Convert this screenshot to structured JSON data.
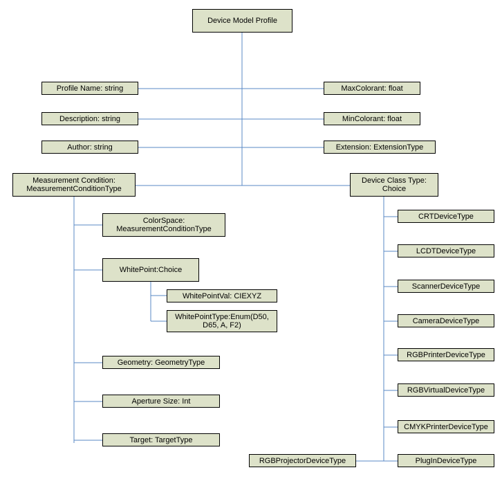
{
  "root": "Device Model Profile",
  "attrs": {
    "profileName": "Profile Name: string",
    "description": "Description: string",
    "author": "Author: string",
    "maxColorant": "MaxColorant: float",
    "minColorant": "MinColorant: float",
    "extension": "Extension: ExtensionType"
  },
  "measurement": {
    "header": "Measurement Condition:\nMeasurementConditionType",
    "colorSpace": "ColorSpace:\nMeasurementConditionType",
    "whitePoint": "WhitePoint:Choice",
    "whitePointVal": "WhitePointVal: CIEXYZ",
    "whitePointType": "WhitePointType:Enum(D50,\nD65, A, F2)",
    "geometry": "Geometry: GeometryType",
    "aperture": "Aperture Size: Int",
    "target": "Target: TargetType"
  },
  "deviceClass": {
    "header": "Device Class Type:\nChoice",
    "types": [
      "CRTDeviceType",
      "LCDTDeviceType",
      "ScannerDeviceType",
      "CameraDeviceType",
      "RGBPrinterDeviceType",
      "RGBVirtualDeviceType",
      "CMYKPrinterDeviceType",
      "PlugInDeviceType"
    ],
    "projector": "RGBProjectorDeviceType"
  },
  "chart_data": {
    "type": "tree",
    "title": "Device Model Profile hierarchy",
    "root": {
      "name": "Device Model Profile",
      "children": [
        {
          "name": "Profile Name",
          "type": "string"
        },
        {
          "name": "Description",
          "type": "string"
        },
        {
          "name": "Author",
          "type": "string"
        },
        {
          "name": "MaxColorant",
          "type": "float"
        },
        {
          "name": "MinColorant",
          "type": "float"
        },
        {
          "name": "Extension",
          "type": "ExtensionType"
        },
        {
          "name": "Measurement Condition",
          "type": "MeasurementConditionType",
          "children": [
            {
              "name": "ColorSpace",
              "type": "MeasurementConditionType"
            },
            {
              "name": "WhitePoint",
              "type": "Choice",
              "children": [
                {
                  "name": "WhitePointVal",
                  "type": "CIEXYZ"
                },
                {
                  "name": "WhitePointType",
                  "type": "Enum(D50, D65, A, F2)"
                }
              ]
            },
            {
              "name": "Geometry",
              "type": "GeometryType"
            },
            {
              "name": "Aperture Size",
              "type": "Int"
            },
            {
              "name": "Target",
              "type": "TargetType"
            }
          ]
        },
        {
          "name": "Device Class Type",
          "type": "Choice",
          "children": [
            {
              "name": "CRTDeviceType"
            },
            {
              "name": "LCDTDeviceType"
            },
            {
              "name": "ScannerDeviceType"
            },
            {
              "name": "CameraDeviceType"
            },
            {
              "name": "RGBPrinterDeviceType"
            },
            {
              "name": "RGBVirtualDeviceType"
            },
            {
              "name": "CMYKPrinterDeviceType"
            },
            {
              "name": "PlugInDeviceType"
            },
            {
              "name": "RGBProjectorDeviceType"
            }
          ]
        }
      ]
    }
  }
}
